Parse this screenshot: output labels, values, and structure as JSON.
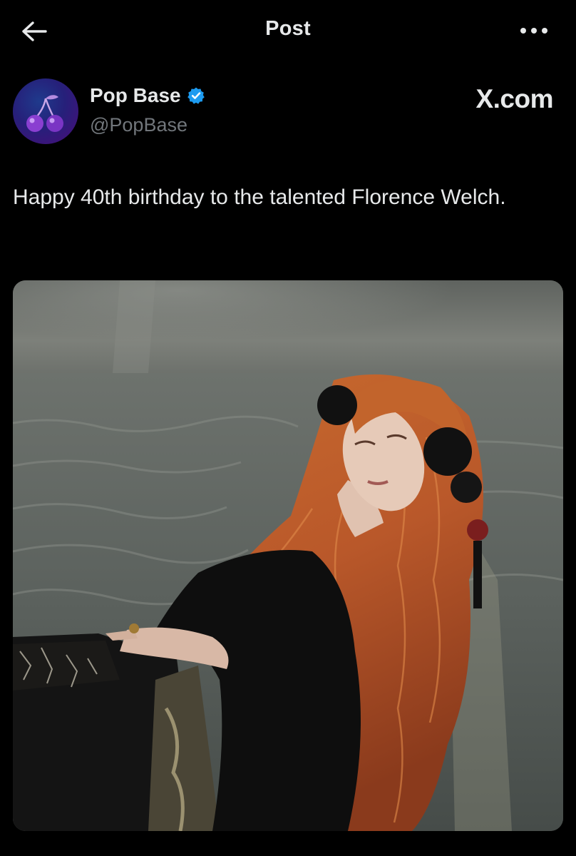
{
  "header": {
    "title": "Post",
    "back_icon": "arrow-left-icon",
    "more_icon": "more-horizontal-icon"
  },
  "author": {
    "name": "Pop Base",
    "handle": "@PopBase",
    "verified": true,
    "verified_color": "#1d9bf0",
    "avatar_icon": "cherries-icon"
  },
  "source": {
    "label": "X.com"
  },
  "tweet": {
    "text": "Happy 40th birthday to the talented Florence Welch."
  },
  "colors": {
    "background": "#000000",
    "text_primary": "#e7e9ea",
    "text_secondary": "#71767b"
  }
}
